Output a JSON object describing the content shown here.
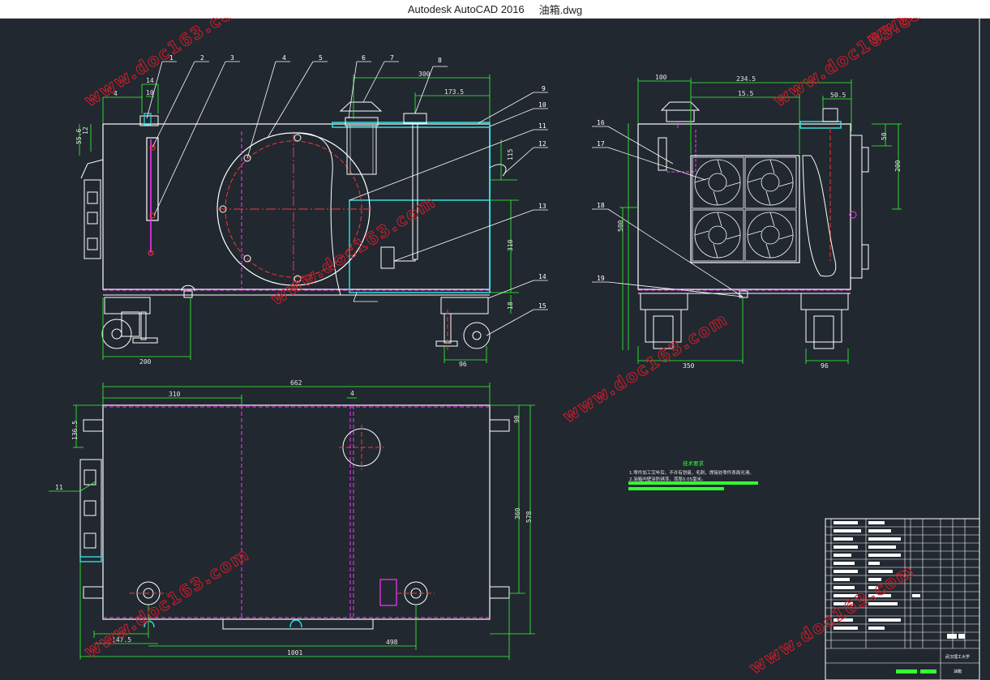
{
  "window": {
    "app_title": "Autodesk AutoCAD 2016",
    "file_name": "油箱.dwg"
  },
  "watermark": "www.doc163.com",
  "part_labels": [
    "1",
    "2",
    "3",
    "4",
    "5",
    "6",
    "7",
    "8",
    "9",
    "10",
    "11",
    "12",
    "13",
    "14",
    "15",
    "16",
    "17",
    "18",
    "19"
  ],
  "front_view": {
    "dims": {
      "d14": "14",
      "d10": "10",
      "d4": "4",
      "d12": "12",
      "d55_6": "55.6",
      "d300": "300",
      "d173_5": "173.5",
      "d115": "115",
      "d310": "310",
      "d18": "18",
      "d200": "200",
      "d96": "96"
    }
  },
  "side_view": {
    "dims": {
      "d100": "100",
      "d234_5": "234.5",
      "d15_5": "15.5",
      "d50_5": "50.5",
      "d50": "50",
      "d200": "200",
      "d500": "500",
      "d350": "350",
      "d96": "96"
    }
  },
  "top_view": {
    "dims": {
      "d310": "310",
      "d662": "662",
      "d4": "4",
      "d136_5": "136.5",
      "d90": "90",
      "d360": "360",
      "d578": "578",
      "d11": "11",
      "d147_5": "147.5",
      "d498": "498",
      "d1001": "1001"
    }
  },
  "tech_notes": {
    "title": "技术要求",
    "line1": "1.零件加工完毕后，不许有划痕，毛刺，焊接处零件表面光滑。",
    "line2": "2.油箱内壁涂防锈漆，漆厚0.05毫米。"
  },
  "title_block": {
    "school": "武汉理工大学",
    "drawing_name": "油箱"
  },
  "colors": {
    "background": "#212830",
    "outline": "#ffffff",
    "dimension": "#33ff33",
    "center_line": "#ff3333",
    "hidden_line": "#ff33ff",
    "fill_hatch": "#33dddd",
    "watermark": "#c81e2a"
  }
}
